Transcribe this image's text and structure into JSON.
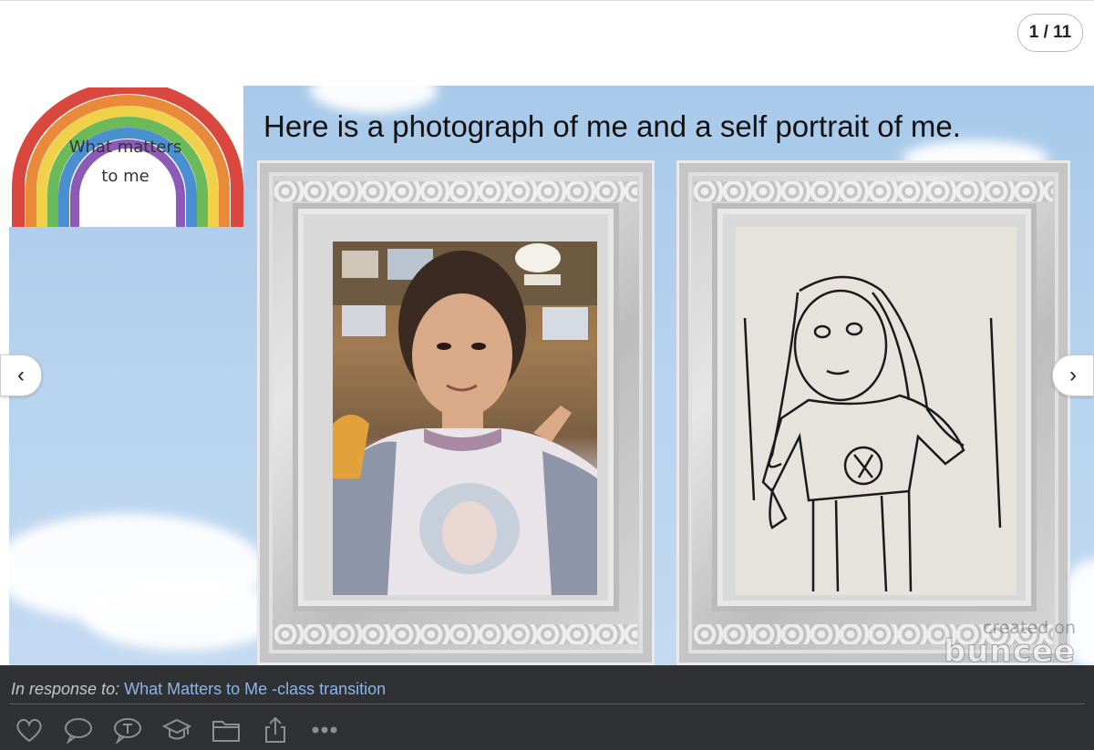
{
  "pager": {
    "counter": "1 / 11"
  },
  "slide": {
    "logo_text": "What matters to me",
    "heading": "Here is a photograph of me and a self portrait of me.",
    "watermark_created": "created on",
    "watermark_brand": "buncee"
  },
  "nav": {
    "prev_glyph": "‹",
    "next_glyph": "›"
  },
  "footer": {
    "response_prefix": "In response to:",
    "response_link": "What Matters to Me -class transition",
    "actions": [
      "heart-icon",
      "comment-icon",
      "teacher-comment-icon",
      "graduation-cap-icon",
      "folder-icon",
      "share-icon",
      "more-icon"
    ]
  },
  "colors": {
    "footer_bg": "#2f3134",
    "link": "#8fb5e6",
    "sky": "#b7d3ee"
  }
}
